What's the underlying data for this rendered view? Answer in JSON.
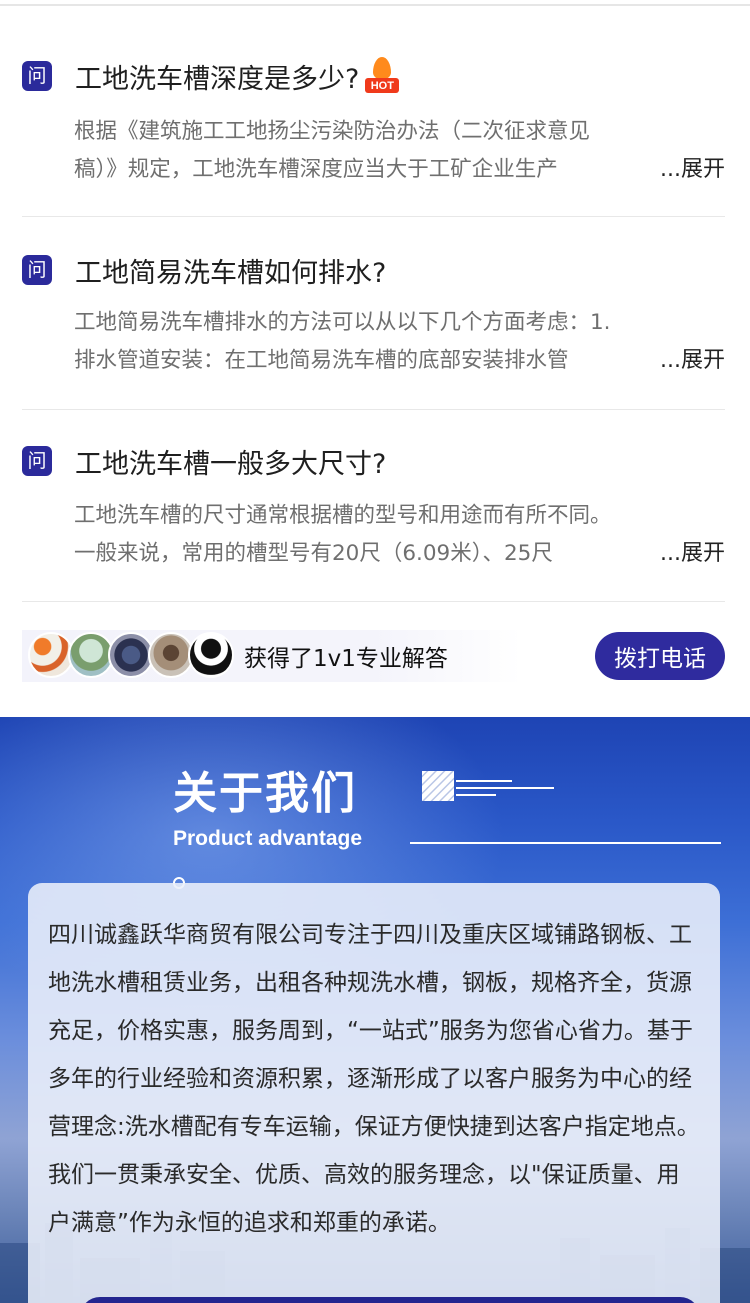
{
  "faq": [
    {
      "badge": "问",
      "question": "工地洗车槽深度是多少?",
      "hot_label": "HOT",
      "answer_line1": "根据《建筑施工工地扬尘污染防治办法（二次征求意见",
      "answer_line2": "稿）》规定，工地洗车槽深度应当大于工矿企业生产",
      "expand_label": "...展开"
    },
    {
      "badge": "问",
      "question": "工地简易洗车槽如何排水?",
      "answer_line1": "工地简易洗车槽排水的方法可以从以下几个方面考虑：1.",
      "answer_line2": "排水管道安装：在工地简易洗车槽的底部安装排水管",
      "expand_label": "...展开"
    },
    {
      "badge": "问",
      "question": "工地洗车槽一般多大尺寸?",
      "answer_line1": "工地洗车槽的尺寸通常根据槽的型号和用途而有所不同。",
      "answer_line2": "一般来说，常用的槽型号有20尺（6.09米）、25尺",
      "expand_label": "...展开"
    }
  ],
  "call_bar": {
    "text": "获得了1v1专业解答",
    "button_label": "拨打电话"
  },
  "about": {
    "title": "关于我们",
    "subtitle": "Product advantage",
    "body": "四川诚鑫跃华商贸有限公司专注于四川及重庆区域铺路钢板、工地洗水槽租赁业务，出租各种规洗水槽，钢板，规格齐全，货源充足，价格实惠，服务周到，“一站式”服务为您省心省力。基于多年的行业经验和资源积累，逐渐形成了以客户服务为中心的经营理念:洗水槽配有专车运输，保证方便快捷到达客户指定地点。我们一贯秉承安全、优质、高效的服务理念，以\"保证质量、用户满意”作为永恒的追求和郑重的承诺。"
  },
  "colors": {
    "accent": "#2b2a9b",
    "hot": "#f03a1b",
    "about_bg": "#2a58c8"
  }
}
